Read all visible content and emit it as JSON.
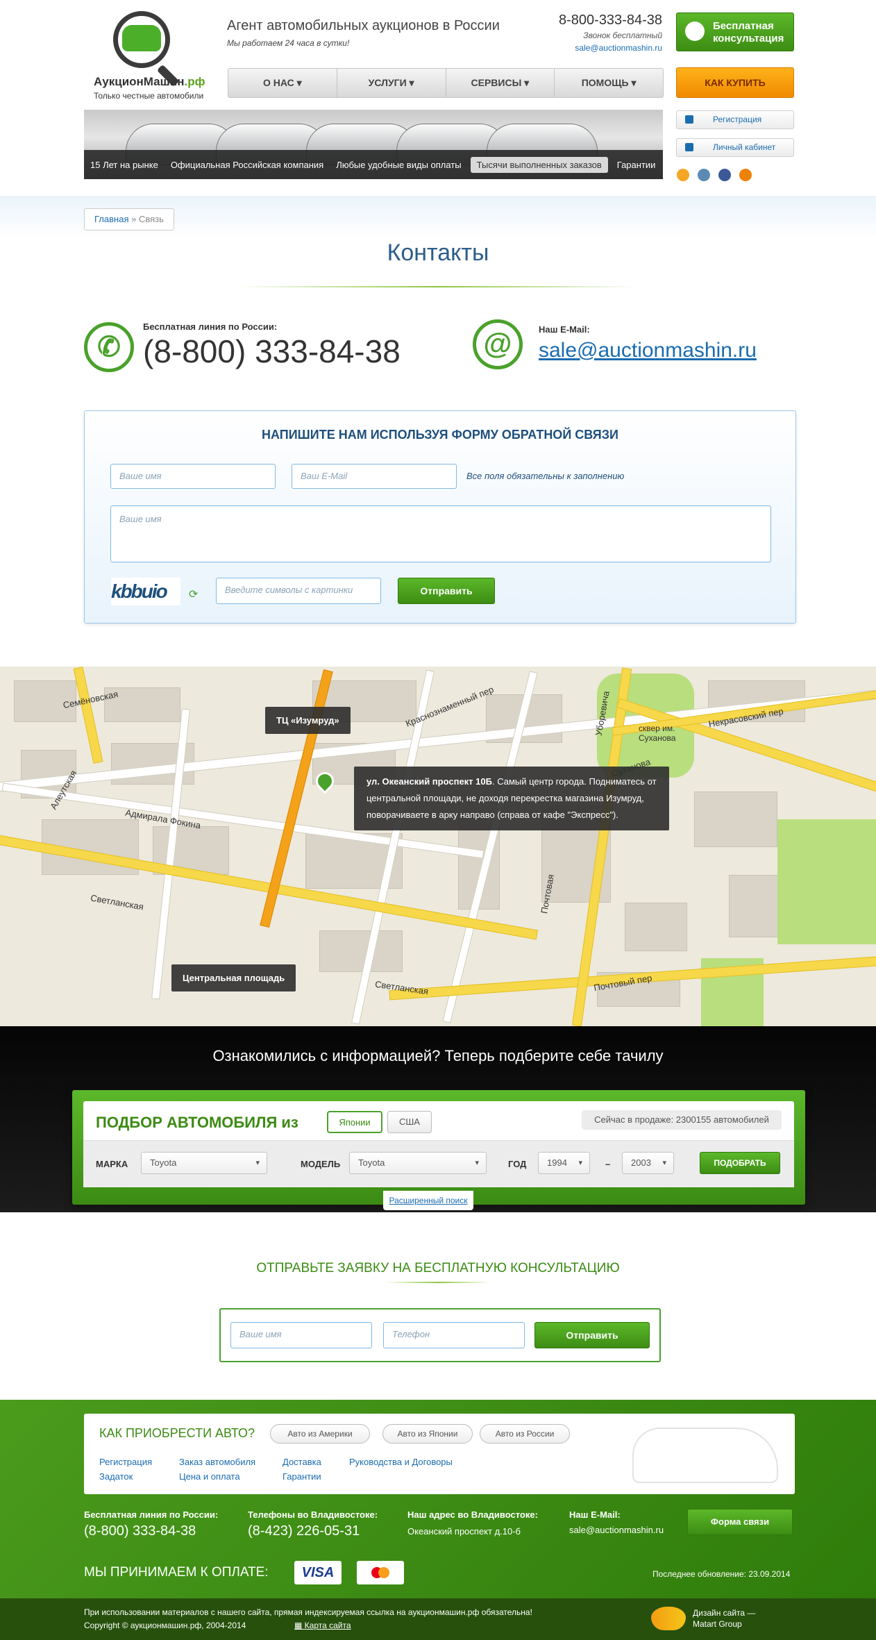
{
  "header": {
    "logo_name": "АукционМашин",
    "logo_tld": ".рф",
    "logo_sub": "Только честные автомобили",
    "tagline": "Агент автомобильных аукционов в России",
    "tagline_sub": "Мы работаем 24 часа в сутки!",
    "phone": "8-800-333-84-38",
    "phone_sub": "Звонок бесплатный",
    "email": "sale@auctionmashin.ru",
    "consult_btn": "Бесплатная консультация",
    "howbuy_btn": "КАК КУПИТЬ",
    "register": "Регистрация",
    "cabinet": "Личный кабинет",
    "nav": [
      "О НАС",
      "УСЛУГИ",
      "СЕРВИСЫ",
      "ПОМОЩЬ"
    ],
    "banner": [
      "15 Лет на рынке",
      "Официальная Российская компания",
      "Любые удобные виды оплаты",
      "Тысячи выполненных заказов",
      "Гарантии"
    ],
    "social_colors": [
      "#f5a623",
      "#5b8bb5",
      "#3b5998",
      "#ee8208"
    ]
  },
  "contacts": {
    "breadcrumb_home": "Главная",
    "breadcrumb_sep": "»",
    "breadcrumb_current": "Связь",
    "title": "Контакты",
    "phone_label": "Бесплатная линия по России:",
    "phone": "(8-800) 333-84-38",
    "email_label": "Наш E-Mail:",
    "email": "sale@auctionmashin.ru"
  },
  "form": {
    "title": "НАПИШИТЕ НАМ ИСПОЛЬЗУЯ ФОРМУ ОБРАТНОЙ СВЯЗИ",
    "name_ph": "Ваше имя",
    "email_ph": "Ваш E-Mail",
    "note": "Все поля обязательны к заполнению",
    "msg_ph": "Ваше имя",
    "captcha": "kbbuio",
    "captcha_ph": "Введите символы с картинки",
    "send": "Отправить"
  },
  "map": {
    "tip_top": "ТЦ «Изумруд»",
    "tip_bottom": "Центральная площадь",
    "info_bold": "ул. Океанский проспект 10Б",
    "info_text": ". Самый центр города. Подниматесь от центральной площади, не доходя перекрестка магазина Изумруд, поворачиваете в арку направо (справа от кафе \"Экспресс\").",
    "streets": [
      "Семёновская",
      "Алеутская",
      "Адмирала Фокина",
      "Светланская",
      "Некрасовский пер",
      "сквер им. Суханова",
      "Суханова",
      "Уборевича",
      "Почтовая",
      "Почтовый пер",
      "Краснознаменный пер",
      "Светланская"
    ]
  },
  "selection": {
    "title": "Ознакомились с информацией? Теперь подберите себе тачилу",
    "heading": "ПОДБОР АВТОМОБИЛЯ из",
    "pill_japan": "Японии",
    "pill_usa": "США",
    "available": "Сейчас в продаже: 2300155 автомобилей",
    "make_label": "МАРКА",
    "make": "Toyota",
    "model_label": "МОДЕЛЬ",
    "model": "Toyota",
    "year_label": "ГОД",
    "year_from": "1994",
    "dash": "–",
    "year_to": "2003",
    "submit": "ПОДОБРАТЬ",
    "advanced": "Расширенный поиск"
  },
  "consult": {
    "title": "ОТПРАВЬТЕ ЗАЯВКУ НА БЕСПЛАТНУЮ КОНСУЛЬТАЦИЮ",
    "name_ph": "Ваше имя",
    "phone_ph": "Телефон",
    "send": "Отправить"
  },
  "footer": {
    "heading": "КАК ПРИОБРЕСТИ АВТО?",
    "pills": [
      "Авто из Америки",
      "Авто из Японии",
      "Авто из России"
    ],
    "links": [
      "Регистрация",
      "Заказ автомобиля",
      "Доставка",
      "Руководства и Договоры",
      "Задаток",
      "Цена и оплата",
      "Гарантии"
    ],
    "col1_h": "Бесплатная линия по России:",
    "col1_v": "(8-800) 333-84-38",
    "col2_h": "Телефоны во Владивостоке:",
    "col2_v": "(8-423) 226-05-31",
    "col3_h": "Наш адрес во Владивостоке:",
    "col3_v": "Океанский проспект д.10-б",
    "col4_h": "Наш E-Mail:",
    "col4_v": "sale@auctionmashin.ru",
    "form_btn": "Форма связи",
    "payment": "МЫ ПРИНИМАЕМ К ОПЛАТЕ:",
    "visa": "VISA",
    "updated": "Последнее обновление: 23.09.2014",
    "notice": "При использовании материалов с нашего сайта, прямая индексируемая ссылка на аукционмашин.рф обязательна!",
    "copyright": "Copyright © аукционмашин.рф, 2004-2014",
    "sitemap": "Карта сайта",
    "design": "Дизайн сайта —",
    "design_by": "Matart Group"
  }
}
